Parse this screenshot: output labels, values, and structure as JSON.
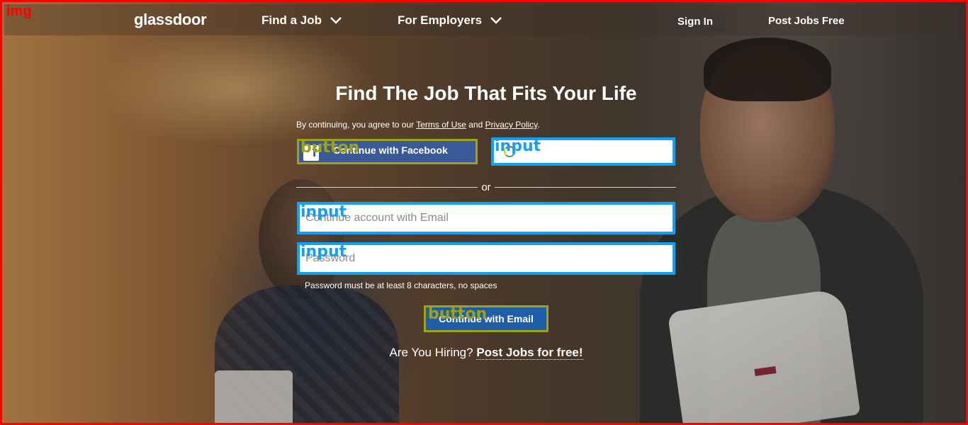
{
  "image_tag": "img",
  "header": {
    "logo": "glassdoor",
    "nav": [
      {
        "label": "Find a Job"
      },
      {
        "label": "For Employers"
      }
    ],
    "sign_in": "Sign In",
    "post_jobs": "Post Jobs Free"
  },
  "main": {
    "title": "Find The Job That Fits Your Life",
    "terms_prefix": "By continuing, you agree to our ",
    "terms_link": "Terms of Use",
    "terms_mid": " and ",
    "privacy_link": "Privacy Policy",
    "terms_suffix": ".",
    "facebook_button": "Continue with Facebook",
    "or": "or",
    "email_placeholder": "Continue account with Email",
    "password_placeholder": "Password",
    "password_hint": "Password must be at least 8 characters, no spaces",
    "email_button": "Continue with Email",
    "hiring_prefix": "Are You Hiring?",
    "hiring_link": "Post Jobs for free!"
  },
  "annotations": {
    "button": "button",
    "input": "input"
  },
  "colors": {
    "facebook": "#3b5998",
    "primary_button": "#1f5ea8",
    "annotation_button": "#9ea314",
    "annotation_input": "#10a1f2",
    "frame": "#ff0000"
  },
  "icons": [
    "chevron-down-icon",
    "facebook-icon",
    "google-icon"
  ]
}
